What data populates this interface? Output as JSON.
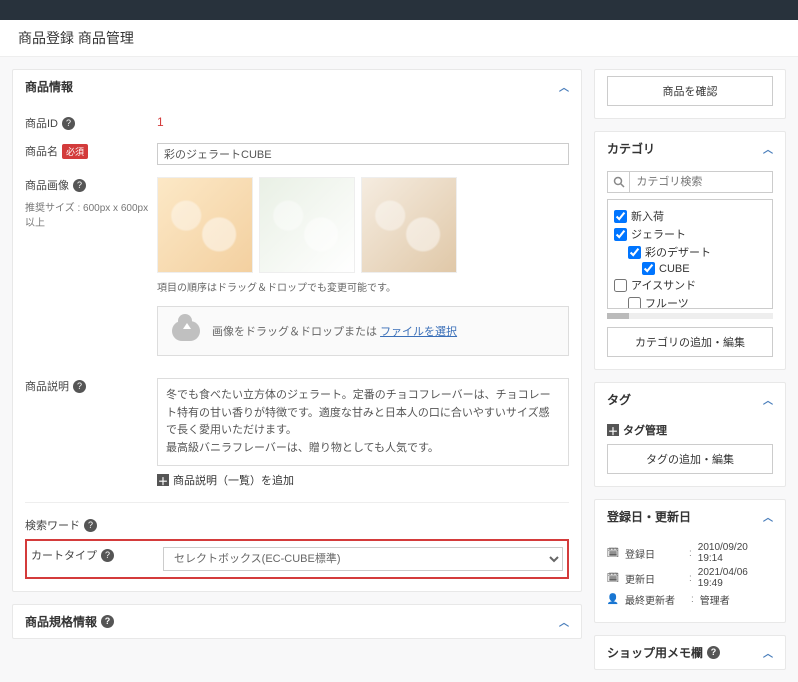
{
  "page": {
    "title": "商品登録 商品管理"
  },
  "card_info": {
    "title": "商品情報",
    "id_label": "商品ID",
    "id_value": "1",
    "name_label": "商品名",
    "name_required": "必須",
    "name_value": "彩のジェラートCUBE",
    "img_label": "商品画像",
    "img_hint": "推奨サイズ : 600px x 600px以上",
    "drag_note": "項目の順序はドラッグ＆ドロップでも変更可能です。",
    "dropzone_text": "画像をドラッグ＆ドロップまたは",
    "dropzone_link": "ファイルを選択",
    "desc_label": "商品説明",
    "desc_value": "冬でも食べたい立方体のジェラート。定番のチョコフレーバーは、チョコレート特有の甘い香りが特徴です。適度な甘みと日本人の口に合いやすいサイズ感で長く愛用いただけます。\n最高級バニラフレーバーは、贈り物としても人気です。",
    "add_desc": "商品説明（一覧）を追加",
    "search_word_label": "検索ワード",
    "cart_type_label": "カートタイプ",
    "cart_type_value": "セレクトボックス(EC-CUBE標準)",
    "spec_title": "商品規格情報"
  },
  "side_confirm": {
    "button": "商品を確認"
  },
  "side_category": {
    "title": "カテゴリ",
    "search_placeholder": "カテゴリ検索",
    "items": [
      {
        "label": "新入荷",
        "checked": true,
        "indent": 0
      },
      {
        "label": "ジェラート",
        "checked": true,
        "indent": 0
      },
      {
        "label": "彩のデザート",
        "checked": true,
        "indent": 1
      },
      {
        "label": "CUBE",
        "checked": true,
        "indent": 2
      },
      {
        "label": "アイスサンド",
        "checked": false,
        "indent": 0
      },
      {
        "label": "フルーツ",
        "checked": false,
        "indent": 1
      }
    ],
    "add_button": "カテゴリの追加・編集"
  },
  "side_tag": {
    "title": "タグ",
    "manage": "タグ管理",
    "add_button": "タグの追加・編集"
  },
  "side_dates": {
    "title": "登録日・更新日",
    "rows": [
      {
        "label": "登録日",
        "value": "2010/09/20 19:14"
      },
      {
        "label": "更新日",
        "value": "2021/04/06 19:49"
      },
      {
        "label": "最終更新者",
        "value": "管理者"
      }
    ]
  },
  "side_memo": {
    "title": "ショップ用メモ欄"
  }
}
